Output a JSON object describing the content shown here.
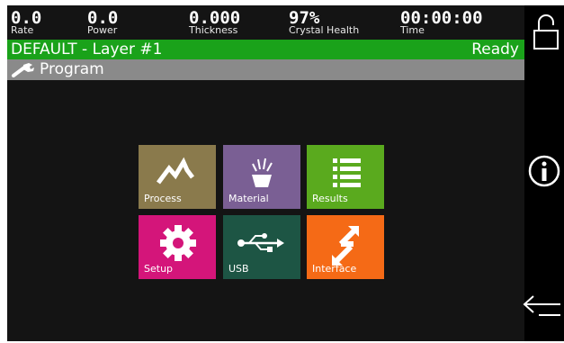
{
  "stats": [
    {
      "value": "0.0",
      "label": "Rate"
    },
    {
      "value": "0.0",
      "label": "Power"
    },
    {
      "value": "0.000",
      "label": "Thickness"
    },
    {
      "value": "97%",
      "label": "Crystal Health"
    },
    {
      "value": "00:00:00",
      "label": "Time"
    }
  ],
  "status": {
    "layer": "DEFAULT - Layer #1",
    "state": "Ready"
  },
  "menu": {
    "title": "Program"
  },
  "tiles": [
    {
      "label": "Process",
      "color": "#8a7a4c",
      "icon": "process-icon"
    },
    {
      "label": "Material",
      "color": "#7a5f94",
      "icon": "material-icon"
    },
    {
      "label": "Results",
      "color": "#5aaa1e",
      "icon": "results-icon"
    },
    {
      "label": "Setup",
      "color": "#d4157a",
      "icon": "gear-icon"
    },
    {
      "label": "USB",
      "color": "#1d5544",
      "icon": "usb-icon"
    },
    {
      "label": "Interface",
      "color": "#f56a16",
      "icon": "interface-icon"
    }
  ],
  "sidebar": {
    "icons": [
      "lock-icon",
      "info-icon",
      "back-arrow-icon"
    ]
  }
}
